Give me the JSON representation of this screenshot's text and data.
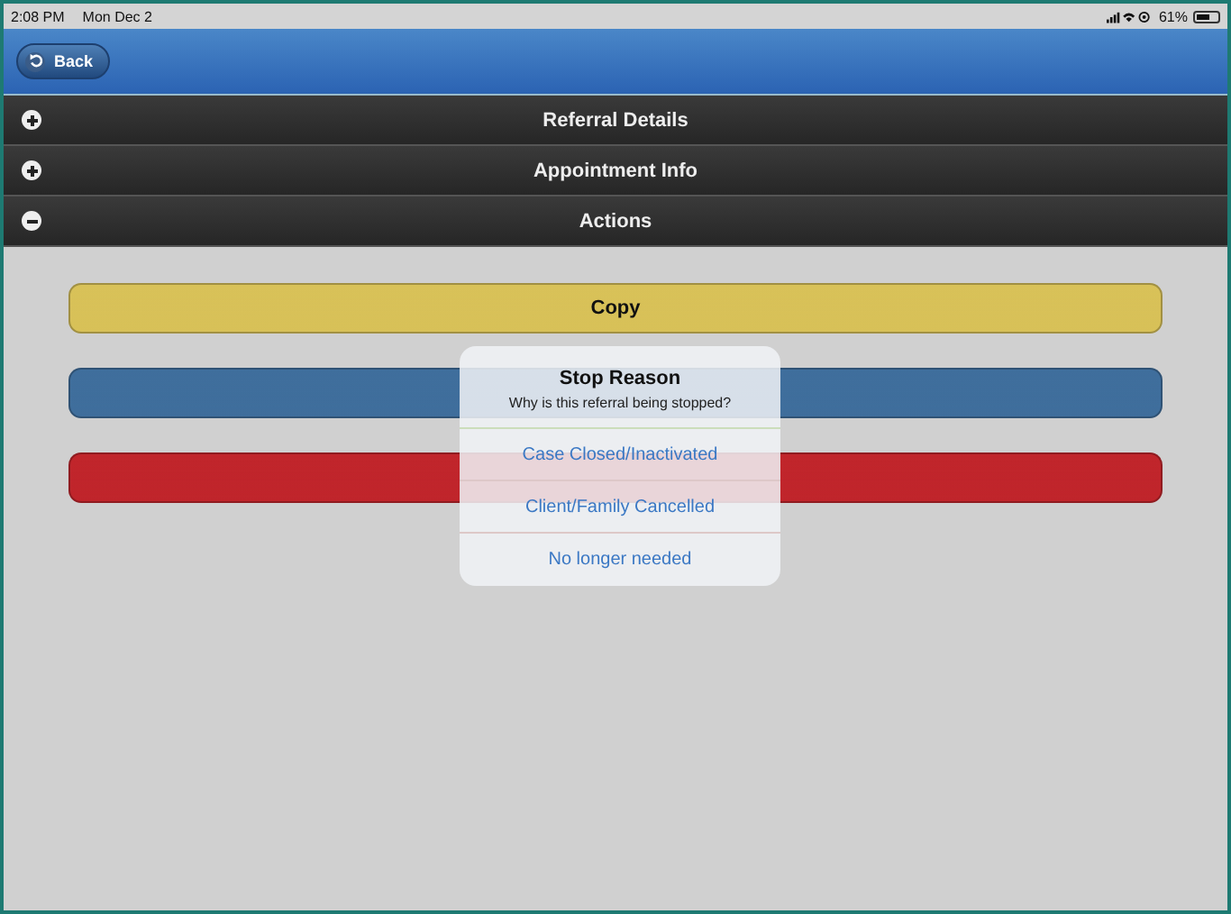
{
  "status_bar": {
    "time": "2:08 PM",
    "date": "Mon Dec 2",
    "battery_text": "61%"
  },
  "header": {
    "back_label": "Back"
  },
  "sections": [
    {
      "title": "Referral Details",
      "expanded": false
    },
    {
      "title": "Appointment Info",
      "expanded": false
    },
    {
      "title": "Actions",
      "expanded": true
    }
  ],
  "actions": [
    {
      "label": "Copy",
      "color": "#d8c158"
    },
    {
      "color": "#3f6e9c"
    },
    {
      "color": "#c0252b"
    }
  ],
  "dialog": {
    "title": "Stop Reason",
    "message": "Why is this referral being stopped?",
    "options": [
      {
        "label": "Case Closed/Inactivated"
      },
      {
        "label": "Client/Family Cancelled"
      },
      {
        "label": "No longer needed"
      }
    ]
  }
}
